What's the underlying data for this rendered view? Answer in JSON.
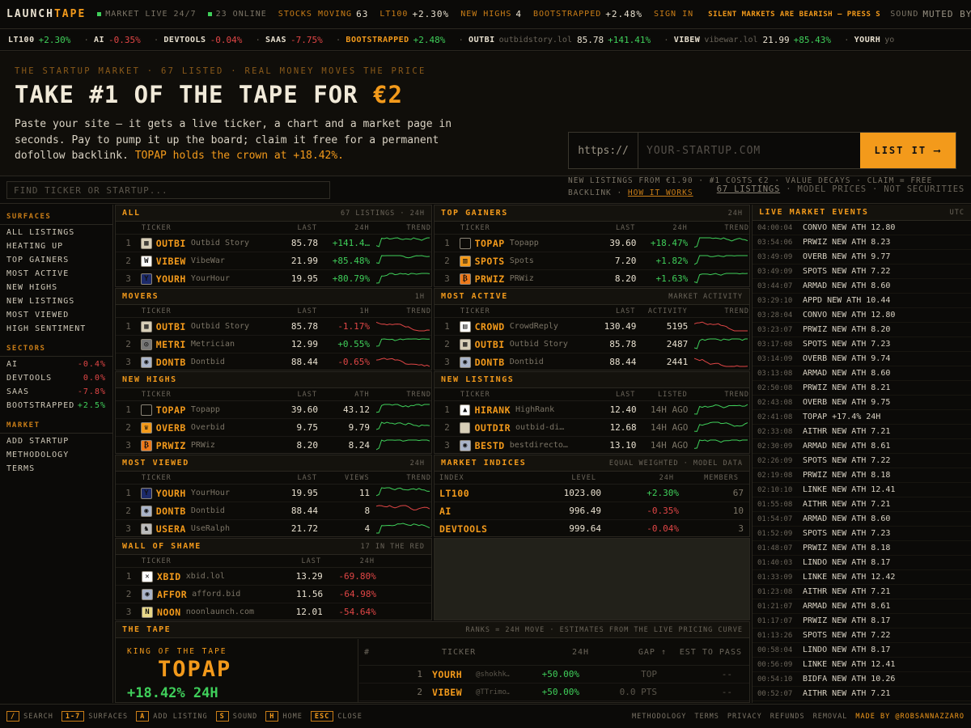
{
  "topbar": {
    "logo_a": "LAUNCH",
    "logo_b": "TAPE",
    "market_live": "MARKET LIVE 24/7",
    "online": "23 ONLINE",
    "stocks_moving_label": "STOCKS MOVING",
    "stocks_moving": "63",
    "lt100_label": "LT100",
    "lt100": "+2.30%",
    "new_highs_label": "NEW HIGHS",
    "new_highs": "4",
    "bootstrapped_label": "BOOTSTRAPPED",
    "bootstrapped": "+2.48%",
    "sign_in": "SIGN IN",
    "silent": "SILENT MARKETS ARE BEARISH — PRESS S",
    "sound_label": "SOUND",
    "sound_state": "MUTED BY B"
  },
  "strip": [
    {
      "sym": "LT100",
      "dom": "",
      "px": "",
      "chg": "+2.30%",
      "dir": "up",
      "white": true
    },
    {
      "sym": "AI",
      "dom": "",
      "px": "",
      "chg": "-0.35%",
      "dir": "dn",
      "white": true
    },
    {
      "sym": "DEVTOOLS",
      "dom": "",
      "px": "",
      "chg": "-0.04%",
      "dir": "dn",
      "white": true
    },
    {
      "sym": "SAAS",
      "dom": "",
      "px": "",
      "chg": "-7.75%",
      "dir": "dn",
      "white": true
    },
    {
      "sym": "BOOTSTRAPPED",
      "dom": "",
      "px": "",
      "chg": "+2.48%",
      "dir": "up",
      "white": false
    },
    {
      "sym": "OUTBI",
      "dom": "outbidstory.lol",
      "px": "85.78",
      "chg": "+141.41%",
      "dir": "up",
      "white": true
    },
    {
      "sym": "VIBEW",
      "dom": "vibewar.lol",
      "px": "21.99",
      "chg": "+85.43%",
      "dir": "up",
      "white": true
    },
    {
      "sym": "YOURH",
      "dom": "yo",
      "px": "",
      "chg": "",
      "dir": "up",
      "white": true
    }
  ],
  "hero": {
    "kicker": "THE STARTUP MARKET · 67 LISTED · REAL MONEY MOVES THE PRICE",
    "headline": "TAKE #1 OF THE TAPE FOR ",
    "price": "€2",
    "desc": "Paste your site — it gets a live ticker, a chart and a market page in seconds. Pay to pump it up the board; claim it free for a permanent dofollow backlink.",
    "crown": "TOPAP holds the crown at +18.42%.",
    "url_prefix": "https://",
    "url_placeholder": "YOUR-STARTUP.COM",
    "list_button": "LIST IT ⟶",
    "note": "NEW LISTINGS FROM €1.90 · #1 COSTS €2 · VALUE DECAYS · CLAIM = FREE BACKLINK · ",
    "how": "HOW IT WORKS"
  },
  "searchrow": {
    "placeholder": "FIND TICKER OR STARTUP...",
    "listings": "67 LISTINGS",
    "model": " · MODEL PRICES · NOT SECURITIES"
  },
  "sidebar": {
    "surfaces_title": "SURFACES",
    "surfaces": [
      "ALL LISTINGS",
      "HEATING UP",
      "TOP GAINERS",
      "MOST ACTIVE",
      "NEW HIGHS",
      "NEW LISTINGS",
      "MOST VIEWED",
      "HIGH SENTIMENT"
    ],
    "sectors_title": "SECTORS",
    "sectors": [
      {
        "name": "AI",
        "chg": "-0.4%",
        "dir": "dn"
      },
      {
        "name": "DEVTOOLS",
        "chg": "0.0%",
        "dir": "dn"
      },
      {
        "name": "SAAS",
        "chg": "-7.8%",
        "dir": "dn"
      },
      {
        "name": "BOOTSTRAPPED",
        "chg": "+2.5%",
        "dir": "up"
      }
    ],
    "market_title": "MARKET",
    "market": [
      "ADD STARTUP",
      "METHODOLOGY",
      "TERMS"
    ]
  },
  "panels": {
    "all": {
      "title": "ALL",
      "right": "67 LISTINGS · 24H",
      "cols": [
        "TICKER",
        "LAST",
        "24H",
        "TREND"
      ],
      "rows": [
        {
          "n": "1",
          "sym": "OUTBI",
          "name": "Outbid Story",
          "last": "85.78",
          "chg": "+141.4…",
          "dir": "up",
          "ic": "#d8cfb8",
          "icc": "▦"
        },
        {
          "n": "2",
          "sym": "VIBEW",
          "name": "VibeWar",
          "last": "21.99",
          "chg": "+85.48%",
          "dir": "up",
          "ic": "#ffffff",
          "icc": "W"
        },
        {
          "n": "3",
          "sym": "YOURH",
          "name": "YourHour",
          "last": "19.95",
          "chg": "+80.79%",
          "dir": "up",
          "ic": "#1c2a6a",
          "icc": "Y"
        }
      ]
    },
    "gainers": {
      "title": "TOP GAINERS",
      "right": "24H",
      "cols": [
        "TICKER",
        "LAST",
        "24H",
        "TREND"
      ],
      "rows": [
        {
          "n": "1",
          "sym": "TOPAP",
          "name": "Topapp",
          "last": "39.60",
          "chg": "+18.47%",
          "dir": "up",
          "ic": "#0c0b08",
          "icc": ""
        },
        {
          "n": "2",
          "sym": "SPOTS",
          "name": "Spots",
          "last": "7.20",
          "chg": "+1.82%",
          "dir": "up",
          "ic": "#f39a1b",
          "icc": "▥"
        },
        {
          "n": "3",
          "sym": "PRWIZ",
          "name": "PRWiz",
          "last": "8.20",
          "chg": "+1.63%",
          "dir": "up",
          "ic": "#f07a1b",
          "icc": "₿"
        }
      ]
    },
    "movers": {
      "title": "MOVERS",
      "right": "1H",
      "cols": [
        "TICKER",
        "LAST",
        "1H",
        "TREND"
      ],
      "rows": [
        {
          "n": "1",
          "sym": "OUTBI",
          "name": "Outbid Story",
          "last": "85.78",
          "chg": "-1.17%",
          "dir": "dn",
          "ic": "#d8cfb8",
          "icc": "▦"
        },
        {
          "n": "2",
          "sym": "METRI",
          "name": "Metrician",
          "last": "12.99",
          "chg": "+0.55%",
          "dir": "up",
          "ic": "#777",
          "icc": "◎"
        },
        {
          "n": "3",
          "sym": "DONTB",
          "name": "Dontbid",
          "last": "88.44",
          "chg": "-0.65%",
          "dir": "dn",
          "ic": "#aab4c8",
          "icc": "◉"
        }
      ]
    },
    "active": {
      "title": "MOST ACTIVE",
      "right": "MARKET ACTIVITY",
      "cols": [
        "TICKER",
        "LAST",
        "ACTIVITY",
        "TREND"
      ],
      "rows": [
        {
          "n": "1",
          "sym": "CROWD",
          "name": "CrowdReply",
          "last": "130.49",
          "chg": "5195",
          "dir": "dn",
          "ic": "#ffffff",
          "icc": "▤"
        },
        {
          "n": "2",
          "sym": "OUTBI",
          "name": "Outbid Story",
          "last": "85.78",
          "chg": "2487",
          "dir": "up",
          "ic": "#d8cfb8",
          "icc": "▦"
        },
        {
          "n": "3",
          "sym": "DONTB",
          "name": "Dontbid",
          "last": "88.44",
          "chg": "2441",
          "dir": "dn",
          "ic": "#aab4c8",
          "icc": "◉"
        }
      ]
    },
    "highs": {
      "title": "NEW HIGHS",
      "right": "",
      "cols": [
        "TICKER",
        "LAST",
        "ATH",
        "TREND"
      ],
      "rows": [
        {
          "n": "1",
          "sym": "TOPAP",
          "name": "Topapp",
          "last": "39.60",
          "chg": "43.12",
          "dir": "up",
          "ic": "#0c0b08",
          "icc": ""
        },
        {
          "n": "2",
          "sym": "OVERB",
          "name": "Overbid",
          "last": "9.75",
          "chg": "9.79",
          "dir": "up",
          "ic": "#f39a1b",
          "icc": "♛"
        },
        {
          "n": "3",
          "sym": "PRWIZ",
          "name": "PRWiz",
          "last": "8.20",
          "chg": "8.24",
          "dir": "up",
          "ic": "#f07a1b",
          "icc": "₿"
        }
      ]
    },
    "listings": {
      "title": "NEW LISTINGS",
      "right": "",
      "cols": [
        "TICKER",
        "LAST",
        "LISTED",
        "TREND"
      ],
      "rows": [
        {
          "n": "1",
          "sym": "HIRANK",
          "name": "HighRank",
          "last": "12.40",
          "chg": "14H AGO",
          "dir": "up",
          "ic": "#ffffff",
          "icc": "▲"
        },
        {
          "n": "2",
          "sym": "OUTDIR",
          "name": "outbid-di…",
          "last": "12.68",
          "chg": "14H AGO",
          "dir": "up",
          "ic": "#d8cfb8",
          "icc": ""
        },
        {
          "n": "3",
          "sym": "BESTD",
          "name": "bestdirecto…",
          "last": "13.10",
          "chg": "14H AGO",
          "dir": "up",
          "ic": "#aab4c8",
          "icc": "◉"
        }
      ]
    },
    "viewed": {
      "title": "MOST VIEWED",
      "right": "24H",
      "cols": [
        "TICKER",
        "LAST",
        "VIEWS",
        "TREND"
      ],
      "rows": [
        {
          "n": "1",
          "sym": "YOURH",
          "name": "YourHour",
          "last": "19.95",
          "chg": "11",
          "dir": "up",
          "ic": "#1c2a6a",
          "icc": "Y"
        },
        {
          "n": "2",
          "sym": "DONTB",
          "name": "Dontbid",
          "last": "88.44",
          "chg": "8",
          "dir": "dn",
          "ic": "#aab4c8",
          "icc": "◉"
        },
        {
          "n": "3",
          "sym": "USERA",
          "name": "UseRalph",
          "last": "21.72",
          "chg": "4",
          "dir": "up",
          "ic": "#bbb",
          "icc": "♞"
        }
      ]
    },
    "indices": {
      "title": "MARKET INDICES",
      "right": "EQUAL WEIGHTED · MODEL DATA",
      "cols": [
        "INDEX",
        "LEVEL",
        "24H",
        "MEMBERS"
      ],
      "rows": [
        {
          "name": "LT100",
          "level": "1023.00",
          "chg": "+2.30%",
          "dir": "up",
          "members": "67"
        },
        {
          "name": "AI",
          "level": "996.49",
          "chg": "-0.35%",
          "dir": "dn",
          "members": "10"
        },
        {
          "name": "DEVTOOLS",
          "level": "999.64",
          "chg": "-0.04%",
          "dir": "dn",
          "members": "3"
        }
      ]
    },
    "shame": {
      "title": "WALL OF SHAME",
      "right": "17 IN THE RED",
      "cols": [
        "TICKER",
        "LAST",
        "24H"
      ],
      "rows": [
        {
          "n": "1",
          "sym": "XBID",
          "name": "xbid.lol",
          "last": "13.29",
          "chg": "-69.80%",
          "dir": "dn",
          "ic": "#ffffff",
          "icc": "✕"
        },
        {
          "n": "2",
          "sym": "AFFOR",
          "name": "afford.bid",
          "last": "11.56",
          "chg": "-64.98%",
          "dir": "dn",
          "ic": "#aab4c8",
          "icc": "◉"
        },
        {
          "n": "3",
          "sym": "NOON",
          "name": "noonlaunch.com",
          "last": "12.01",
          "chg": "-54.64%",
          "dir": "dn",
          "ic": "#e9d98a",
          "icc": "N"
        }
      ]
    }
  },
  "tape": {
    "title": "THE TAPE",
    "right": "RANKS = 24H MOVE · ESTIMATES FROM THE LIVE PRICING CURVE",
    "king_label": "KING OF THE TAPE",
    "king_name": "TOPAP",
    "king_chg": "+18.42% 24H",
    "cols": [
      "#",
      "TICKER",
      "24H",
      "GAP ↑",
      "EST TO PASS"
    ],
    "rows": [
      {
        "n": "1",
        "sym": "YOURH",
        "user": "@shokhk…",
        "chg": "+50.00%",
        "gap": "TOP",
        "est": "--"
      },
      {
        "n": "2",
        "sym": "VIBEW",
        "user": "@TTrimo…",
        "chg": "+50.00%",
        "gap": "0.0 PTS",
        "est": "--"
      }
    ]
  },
  "events": {
    "title": "LIVE MARKET EVENTS",
    "right": "UTC",
    "items": [
      {
        "t": "04:00:04",
        "x": "CONVO NEW ATH 12.80"
      },
      {
        "t": "03:54:06",
        "x": "PRWIZ NEW ATH 8.23"
      },
      {
        "t": "03:49:09",
        "x": "OVERB NEW ATH 9.77"
      },
      {
        "t": "03:49:09",
        "x": "SPOTS NEW ATH 7.22"
      },
      {
        "t": "03:44:07",
        "x": "ARMAD NEW ATH 8.60"
      },
      {
        "t": "03:29:10",
        "x": "APPD NEW ATH 10.44"
      },
      {
        "t": "03:28:04",
        "x": "CONVO NEW ATH 12.80"
      },
      {
        "t": "03:23:07",
        "x": "PRWIZ NEW ATH 8.20"
      },
      {
        "t": "03:17:08",
        "x": "SPOTS NEW ATH 7.23"
      },
      {
        "t": "03:14:09",
        "x": "OVERB NEW ATH 9.74"
      },
      {
        "t": "03:13:08",
        "x": "ARMAD NEW ATH 8.60"
      },
      {
        "t": "02:50:08",
        "x": "PRWIZ NEW ATH 8.21"
      },
      {
        "t": "02:43:08",
        "x": "OVERB NEW ATH 9.75"
      },
      {
        "t": "02:41:08",
        "x": "TOPAP +17.4% 24H"
      },
      {
        "t": "02:33:08",
        "x": "AITHR NEW ATH 7.21"
      },
      {
        "t": "02:30:09",
        "x": "ARMAD NEW ATH 8.61"
      },
      {
        "t": "02:26:09",
        "x": "SPOTS NEW ATH 7.22"
      },
      {
        "t": "02:19:08",
        "x": "PRWIZ NEW ATH 8.18"
      },
      {
        "t": "02:10:10",
        "x": "LINKE NEW ATH 12.41"
      },
      {
        "t": "01:55:08",
        "x": "AITHR NEW ATH 7.21"
      },
      {
        "t": "01:54:07",
        "x": "ARMAD NEW ATH 8.60"
      },
      {
        "t": "01:52:09",
        "x": "SPOTS NEW ATH 7.23"
      },
      {
        "t": "01:48:07",
        "x": "PRWIZ NEW ATH 8.18"
      },
      {
        "t": "01:40:03",
        "x": "LINDO NEW ATH 8.17"
      },
      {
        "t": "01:33:09",
        "x": "LINKE NEW ATH 12.42"
      },
      {
        "t": "01:23:08",
        "x": "AITHR NEW ATH 7.21"
      },
      {
        "t": "01:21:07",
        "x": "ARMAD NEW ATH 8.61"
      },
      {
        "t": "01:17:07",
        "x": "PRWIZ NEW ATH 8.17"
      },
      {
        "t": "01:13:26",
        "x": "SPOTS NEW ATH 7.22"
      },
      {
        "t": "00:58:04",
        "x": "LINDO NEW ATH 8.17"
      },
      {
        "t": "00:56:09",
        "x": "LINKE NEW ATH 12.41"
      },
      {
        "t": "00:54:10",
        "x": "BIDFA NEW ATH 10.26"
      },
      {
        "t": "00:52:07",
        "x": "AITHR NEW ATH 7.21"
      }
    ]
  },
  "footer": {
    "keys": [
      {
        "k": "/",
        "label": "SEARCH"
      },
      {
        "k": "1-7",
        "label": "SURFACES"
      },
      {
        "k": "A",
        "label": "ADD LISTING"
      },
      {
        "k": "S",
        "label": "SOUND"
      },
      {
        "k": "H",
        "label": "HOME"
      },
      {
        "k": "ESC",
        "label": "CLOSE"
      }
    ],
    "links": [
      "METHODOLOGY",
      "TERMS",
      "PRIVACY",
      "REFUNDS",
      "REMOVAL"
    ],
    "made_by": "MADE BY @ROBSANNAZZARO"
  },
  "colors": {
    "accent": "#f39a1b",
    "up": "#3fcf5a",
    "down": "#e14646",
    "bg": "#0b0a08"
  }
}
